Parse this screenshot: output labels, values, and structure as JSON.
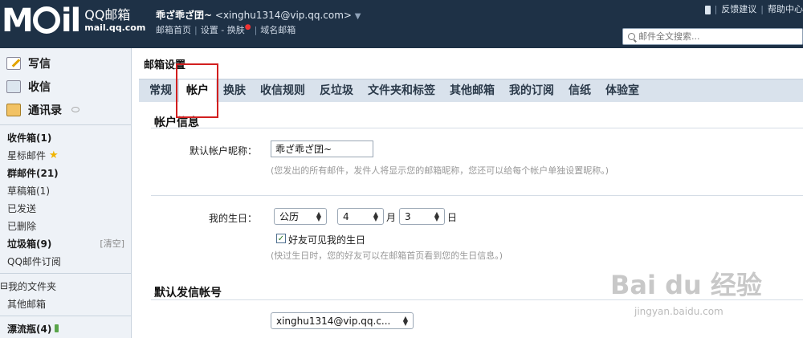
{
  "header": {
    "logo_mark": "M",
    "logo_mark_rest": "il",
    "logo_title": "QQ邮箱",
    "logo_domain": "mail.qq.com",
    "nickname": "乖ざ乖ざ囝~",
    "email": "<xinghu1314@vip.qq.com>",
    "nav": [
      "邮箱首页",
      "设置",
      "换肤",
      "域名邮箱"
    ],
    "nav_dash": "-",
    "links": [
      "反馈建议",
      "帮助中心"
    ],
    "search_placeholder": "邮件全文搜索..."
  },
  "sidebar": {
    "main": [
      {
        "label": "写信",
        "icon": "write-icon"
      },
      {
        "label": "收信",
        "icon": "inbox-icon"
      },
      {
        "label": "通讯录",
        "icon": "contacts-icon"
      }
    ],
    "folders": [
      {
        "label": "收件箱(1)"
      },
      {
        "label": "星标邮件"
      },
      {
        "label": "群邮件(21)"
      },
      {
        "label": "草稿箱(1)"
      },
      {
        "label": "已发送"
      },
      {
        "label": "已删除"
      },
      {
        "label": "垃圾箱(9)",
        "action": "[清空]"
      },
      {
        "label": "QQ邮件订阅"
      }
    ],
    "other": [
      {
        "label": "我的文件夹",
        "prefix": "⊟"
      },
      {
        "label": "其他邮箱"
      }
    ],
    "bottle": {
      "label": "漂流瓶(4)"
    }
  },
  "main": {
    "title": "邮箱设置",
    "tabs": [
      "常规",
      "帐户",
      "换肤",
      "收信规则",
      "反垃圾",
      "文件夹和标签",
      "其他邮箱",
      "我的订阅",
      "信纸",
      "体验室"
    ],
    "active_tab": "帐户",
    "account_info": {
      "section_title": "帐户信息",
      "nickname_label": "默认帐户昵称：",
      "nickname_value": "乖ざ乖ざ囝~",
      "nickname_hint": "(您发出的所有邮件，发件人将显示您的邮箱昵称，您还可以给每个帐户单独设置昵称。)",
      "birthday_label": "我的生日：",
      "calendar": "公历",
      "month": "4",
      "month_unit": "月",
      "day": "3",
      "day_unit": "日",
      "show_birthday_label": "好友可见我的生日",
      "show_birthday_checked": true,
      "birthday_hint": "(快过生日时，您的好友可以在邮箱首页看到您的生日信息。)"
    },
    "default_sender": {
      "section_title": "默认发信帐号",
      "value": "xinghu1314@vip.qq.c..."
    }
  },
  "watermark": {
    "brand": "Bai du 经验",
    "url": "jingyan.baidu.com"
  },
  "colors": {
    "header_bg": "#1e3146",
    "sidebar_bg": "#eef2f7",
    "tabbar_bg": "#d9e2ec",
    "highlight": "#d21f1f"
  }
}
